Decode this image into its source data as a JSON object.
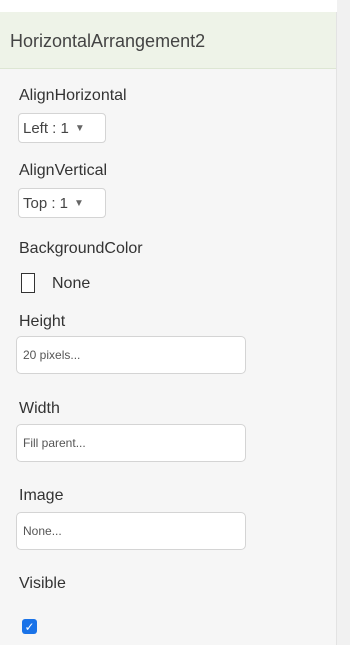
{
  "header": {
    "title": "HorizontalArrangement2"
  },
  "properties": {
    "align_horizontal": {
      "label": "AlignHorizontal",
      "value": "Left : 1"
    },
    "align_vertical": {
      "label": "AlignVertical",
      "value": "Top : 1"
    },
    "background_color": {
      "label": "BackgroundColor",
      "value": "None"
    },
    "height": {
      "label": "Height",
      "value": "20 pixels..."
    },
    "width": {
      "label": "Width",
      "value": "Fill parent..."
    },
    "image": {
      "label": "Image",
      "value": "None..."
    },
    "visible": {
      "label": "Visible",
      "checked": true
    }
  },
  "colors": {
    "header_bg": "#eef3e8",
    "panel_bg": "#f6f6f6",
    "checkbox_bg": "#1a73e8",
    "top_border": "#d7e6c4"
  },
  "icons": {
    "dropdown": "chevron-down-icon",
    "checkbox": "check-icon"
  }
}
